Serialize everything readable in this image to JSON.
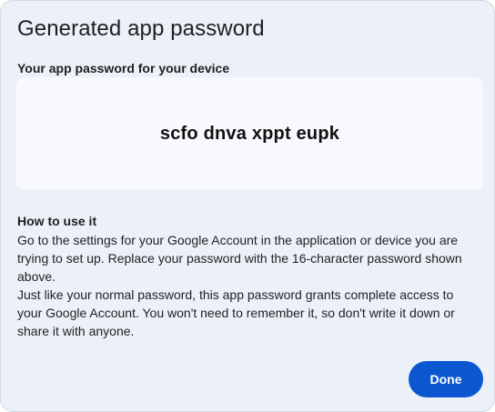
{
  "dialog": {
    "title": "Generated app password",
    "subtitle": "Your app password for your device",
    "password": "scfo dnva xppt eupk",
    "howto": {
      "heading": "How to use it",
      "paragraph_1": "Go to the settings for your Google Account in the application or device you are trying to set up. Replace your password with the 16-character password shown above.",
      "paragraph_2": "Just like your normal password, this app password grants complete access to your Google Account. You won't need to remember it, so don't write it down or share it with anyone."
    },
    "done_label": "Done"
  },
  "colors": {
    "dialog_background": "#ecf1f9",
    "password_background": "#f8f9fd",
    "primary_button": "#0b57d0",
    "text": "#1f1f1f"
  }
}
